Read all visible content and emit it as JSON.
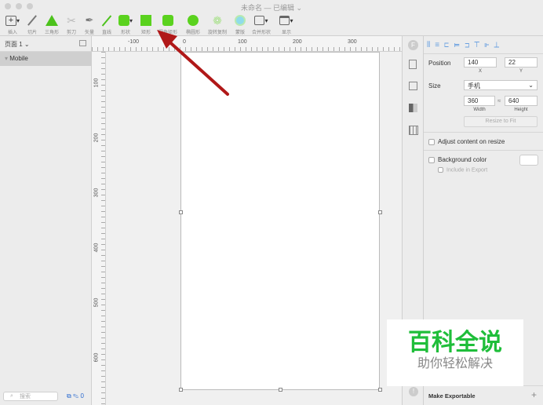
{
  "window": {
    "title": "未命名 — 已编辑 ⌄"
  },
  "toolbar": [
    {
      "label": "插入",
      "icon": "plus-icon"
    },
    {
      "label": "切片",
      "icon": "slice-icon"
    },
    {
      "label": "三角形",
      "icon": "triangle-icon"
    },
    {
      "label": "剪刀",
      "icon": "scissors-icon"
    },
    {
      "label": "矢量",
      "icon": "pen-icon"
    },
    {
      "label": "直线",
      "icon": "line-icon"
    },
    {
      "label": "形状",
      "icon": "shape-icon"
    },
    {
      "label": "矩形",
      "icon": "rectangle-icon"
    },
    {
      "label": "圆角矩形",
      "icon": "rounded-rectangle-icon"
    },
    {
      "label": "椭圆形",
      "icon": "oval-icon"
    },
    {
      "label": "旋转复制",
      "icon": "rotate-copies-icon"
    },
    {
      "label": "蒙版",
      "icon": "mask-icon"
    },
    {
      "label": "合并形状",
      "icon": "combine-icon"
    },
    {
      "label": "显示",
      "icon": "view-icon"
    }
  ],
  "left": {
    "page": "页面 1 ⌄",
    "layer": "Mobile",
    "search_placeholder": "搜索",
    "badge": "0"
  },
  "rulers": {
    "h": [
      "-100",
      "0",
      "100",
      "200",
      "300"
    ],
    "v": [
      "100",
      "200",
      "300",
      "400",
      "500",
      "600"
    ]
  },
  "inspector": {
    "position_label": "Position",
    "x": "140",
    "y": "22",
    "x_label": "X",
    "y_label": "Y",
    "size_label": "Size",
    "preset": "手机",
    "width": "360",
    "height": "640",
    "width_label": "Width",
    "height_label": "Height",
    "resize_fit": "Resize to Fit",
    "adjust": "Adjust content on resize",
    "bg_color": "Background color",
    "include_export": "Include in Export",
    "make_exportable": "Make Exportable",
    "plus": "+"
  },
  "watermark": {
    "title": "百科全说",
    "subtitle": "助你轻松解决"
  },
  "colors": {
    "accent_green": "#5ad21e",
    "arrow": "#b01818"
  }
}
